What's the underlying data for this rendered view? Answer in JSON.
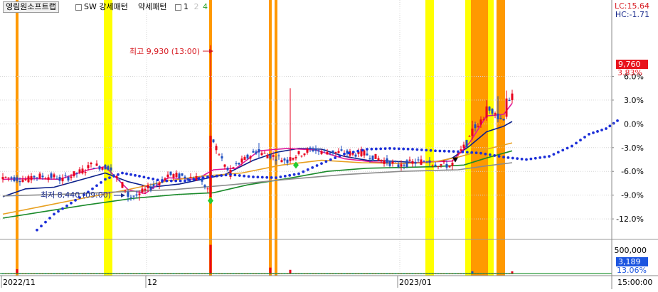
{
  "header": {
    "stock_name": "영림원소프트랩",
    "strong_pattern": "SW 강세패턴",
    "weak_pattern": "약세패턴",
    "page1": "1",
    "page2": "2",
    "page4": "4",
    "lc_label": "LC:15.64",
    "hc_label": "HC:-1.71"
  },
  "annotations": {
    "high": "최고 9,930 (13:00)",
    "low": "최저 8,440 (09:00)"
  },
  "price_badge": {
    "value": "9,760",
    "pct": "3.83%"
  },
  "volume_badge": {
    "value": "3,189",
    "pct": "13.06%"
  },
  "colors": {
    "up": "#e8001c",
    "down": "#1f4fc1",
    "ma_fast": "#e0189a",
    "ma_mid": "#0b1f8a",
    "ma_orange": "#e8a020",
    "ma_green": "#1a8a2a",
    "ma_gray": "#8c8c8c",
    "dots": "#1c2fd8",
    "yellow": "#ffff00",
    "orange": "#ff9900"
  },
  "chart_data": {
    "type": "candlestick",
    "title": "",
    "xlabel": "",
    "ylabel": "",
    "ylim": [
      -14.5,
      15.64
    ],
    "y_ticks": [
      6,
      3,
      0,
      -3,
      -6,
      -9,
      -12
    ],
    "y_tick_labels": [
      "6.0%",
      "3.0%",
      "0.0%",
      "-3.0%",
      "-6.0%",
      "-9.0%",
      "-12.0%"
    ],
    "x_tick_labels": [
      "2022/11",
      "12",
      "2023/01",
      "15:00:00"
    ],
    "volume_tick_label": "500,000",
    "n_bars": 180,
    "yellow_bands": [
      [
        36,
        39
      ],
      [
        149,
        152
      ],
      [
        163,
        165
      ],
      [
        171,
        173
      ]
    ],
    "orange_bands": [
      [
        5,
        6
      ],
      [
        73,
        74
      ],
      [
        94,
        95
      ],
      [
        96,
        97
      ],
      [
        165,
        171
      ],
      [
        174,
        177
      ]
    ],
    "key_candles": [
      {
        "i": 0,
        "o": -7.0,
        "c": -6.7,
        "h": -6.2,
        "l": -7.4
      },
      {
        "i": 10,
        "o": -7.1,
        "c": -6.6,
        "h": -6.2,
        "l": -7.5
      },
      {
        "i": 20,
        "o": -6.7,
        "c": -7.2,
        "h": -6.4,
        "l": -7.6
      },
      {
        "i": 30,
        "o": -5.6,
        "c": -5.2,
        "h": -4.8,
        "l": -5.9
      },
      {
        "i": 38,
        "o": -5.5,
        "c": -5.9,
        "h": -5.1,
        "l": -6.4
      },
      {
        "i": 44,
        "o": -8.6,
        "c": -9.2,
        "h": -8.2,
        "l": -9.8
      },
      {
        "i": 48,
        "o": -9.0,
        "c": -8.8,
        "h": -8.4,
        "l": -9.7
      },
      {
        "i": 58,
        "o": -6.7,
        "c": -6.4,
        "h": -6.0,
        "l": -7.0
      },
      {
        "i": 70,
        "o": -6.9,
        "c": -7.3,
        "h": -6.5,
        "l": -7.7
      },
      {
        "i": 73,
        "o": -9.2,
        "c": -1.5,
        "h": 9.93,
        "l": -9.6
      },
      {
        "i": 80,
        "o": -6.7,
        "c": -5.8,
        "h": -5.2,
        "l": -7.0
      },
      {
        "i": 90,
        "o": -3.2,
        "c": -3.6,
        "h": -2.4,
        "l": -4.3
      },
      {
        "i": 101,
        "o": -4.7,
        "c": -4.2,
        "h": 4.5,
        "l": -5.0
      },
      {
        "i": 110,
        "o": -3.1,
        "c": -3.4,
        "h": -2.7,
        "l": -3.8
      },
      {
        "i": 125,
        "o": -3.8,
        "c": -3.5,
        "h": -3.1,
        "l": -4.2
      },
      {
        "i": 140,
        "o": -5.4,
        "c": -5.1,
        "h": -4.6,
        "l": -5.9
      },
      {
        "i": 150,
        "o": -4.6,
        "c": -4.9,
        "h": -4.2,
        "l": -5.4
      },
      {
        "i": 158,
        "o": -5.3,
        "c": -4.9,
        "h": -4.5,
        "l": -5.8
      },
      {
        "i": 165,
        "o": -1.5,
        "c": -0.6,
        "h": 0.4,
        "l": -2.0
      },
      {
        "i": 170,
        "o": 0.8,
        "c": 2.2,
        "h": 3.0,
        "l": 0.4
      },
      {
        "i": 174,
        "o": 1.3,
        "c": 0.6,
        "h": 3.5,
        "l": 0.2
      },
      {
        "i": 177,
        "o": 0.9,
        "c": 3.2,
        "h": 4.2,
        "l": 0.6
      },
      {
        "i": 179,
        "o": 3.0,
        "c": 3.83,
        "h": 4.3,
        "l": 2.6
      }
    ],
    "series": [
      {
        "type": "line",
        "color": "#0b1f8a",
        "points": [
          [
            0,
            -9.2
          ],
          [
            8,
            -8.2
          ],
          [
            18,
            -8.0
          ],
          [
            28,
            -7.0
          ],
          [
            36,
            -6.2
          ],
          [
            44,
            -7.3
          ],
          [
            52,
            -8.0
          ],
          [
            62,
            -7.6
          ],
          [
            70,
            -7.0
          ],
          [
            78,
            -6.4
          ],
          [
            88,
            -4.6
          ],
          [
            96,
            -3.6
          ],
          [
            104,
            -3.1
          ],
          [
            112,
            -3.2
          ],
          [
            120,
            -4.1
          ],
          [
            128,
            -4.6
          ],
          [
            136,
            -4.7
          ],
          [
            146,
            -4.9
          ],
          [
            154,
            -4.7
          ],
          [
            158,
            -4.3
          ],
          [
            164,
            -2.8
          ],
          [
            170,
            -1.0
          ],
          [
            176,
            -0.3
          ],
          [
            179,
            0.3
          ]
        ]
      },
      {
        "type": "line",
        "color": "#e0189a",
        "points": [
          [
            0,
            -7.0
          ],
          [
            10,
            -6.9
          ],
          [
            20,
            -7.0
          ],
          [
            30,
            -5.8
          ],
          [
            36,
            -5.4
          ],
          [
            44,
            -8.3
          ],
          [
            50,
            -8.8
          ],
          [
            58,
            -6.8
          ],
          [
            68,
            -7.0
          ],
          [
            74,
            -5.8
          ],
          [
            82,
            -5.6
          ],
          [
            90,
            -3.4
          ],
          [
            100,
            -3.1
          ],
          [
            110,
            -3.3
          ],
          [
            120,
            -4.4
          ],
          [
            130,
            -4.8
          ],
          [
            140,
            -5.0
          ],
          [
            150,
            -4.8
          ],
          [
            158,
            -4.7
          ],
          [
            164,
            -2.4
          ],
          [
            170,
            1.0
          ],
          [
            176,
            1.2
          ],
          [
            179,
            2.6
          ]
        ]
      },
      {
        "type": "line",
        "color": "#e8a020",
        "points": [
          [
            0,
            -11.4
          ],
          [
            14,
            -10.4
          ],
          [
            28,
            -9.4
          ],
          [
            44,
            -8.3
          ],
          [
            58,
            -7.2
          ],
          [
            70,
            -6.6
          ],
          [
            84,
            -6.2
          ],
          [
            98,
            -5.2
          ],
          [
            112,
            -4.6
          ],
          [
            126,
            -4.9
          ],
          [
            140,
            -5.0
          ],
          [
            150,
            -4.9
          ],
          [
            160,
            -4.2
          ],
          [
            170,
            -3.2
          ],
          [
            179,
            -2.4
          ]
        ]
      },
      {
        "type": "line",
        "color": "#1a8a2a",
        "points": [
          [
            0,
            -11.9
          ],
          [
            14,
            -11.1
          ],
          [
            30,
            -10.2
          ],
          [
            46,
            -9.4
          ],
          [
            62,
            -8.9
          ],
          [
            74,
            -8.7
          ],
          [
            86,
            -7.7
          ],
          [
            100,
            -6.9
          ],
          [
            114,
            -6.0
          ],
          [
            128,
            -5.6
          ],
          [
            140,
            -5.5
          ],
          [
            152,
            -5.4
          ],
          [
            162,
            -5.2
          ],
          [
            170,
            -4.3
          ],
          [
            179,
            -3.4
          ]
        ]
      },
      {
        "type": "line",
        "color": "#8c8c8c",
        "points": [
          [
            0,
            -9.1
          ],
          [
            20,
            -8.9
          ],
          [
            40,
            -8.6
          ],
          [
            60,
            -8.3
          ],
          [
            80,
            -7.7
          ],
          [
            100,
            -7.0
          ],
          [
            120,
            -6.4
          ],
          [
            140,
            -6.0
          ],
          [
            160,
            -5.8
          ],
          [
            170,
            -5.3
          ],
          [
            179,
            -4.9
          ]
        ]
      },
      {
        "type": "dots",
        "color": "#1c2fd8",
        "points": [
          [
            12,
            -13.4
          ],
          [
            18,
            -11.4
          ],
          [
            24,
            -10.0
          ],
          [
            30,
            -8.6
          ],
          [
            36,
            -7.0
          ],
          [
            42,
            -6.2
          ],
          [
            48,
            -6.6
          ],
          [
            56,
            -7.2
          ],
          [
            64,
            -7.2
          ],
          [
            72,
            -6.7
          ],
          [
            80,
            -6.4
          ],
          [
            88,
            -6.7
          ],
          [
            96,
            -6.8
          ],
          [
            104,
            -6.3
          ],
          [
            112,
            -5.0
          ],
          [
            120,
            -3.8
          ],
          [
            128,
            -3.2
          ],
          [
            136,
            -3.1
          ],
          [
            144,
            -3.2
          ],
          [
            152,
            -3.4
          ],
          [
            160,
            -3.5
          ],
          [
            168,
            -3.7
          ],
          [
            176,
            -4.2
          ],
          [
            184,
            -4.5
          ],
          [
            192,
            -4.1
          ],
          [
            200,
            -2.8
          ],
          [
            206,
            -1.3
          ],
          [
            212,
            -0.6
          ],
          [
            216,
            0.4
          ]
        ]
      }
    ],
    "volume": [
      {
        "i": 5,
        "v": 5400
      },
      {
        "i": 73,
        "v": 32000
      },
      {
        "i": 94,
        "v": 7200
      },
      {
        "i": 101,
        "v": 4800
      },
      {
        "i": 165,
        "v": 3200
      },
      {
        "i": 179,
        "v": 3189
      }
    ],
    "markers": [
      {
        "kind": "up",
        "i": 73,
        "y": -9.7,
        "color": "#22cc33"
      },
      {
        "kind": "up",
        "i": 103,
        "y": -5.2,
        "color": "#22cc33"
      },
      {
        "kind": "down",
        "i": 159,
        "y": -4.6,
        "color": "#000000"
      }
    ]
  }
}
